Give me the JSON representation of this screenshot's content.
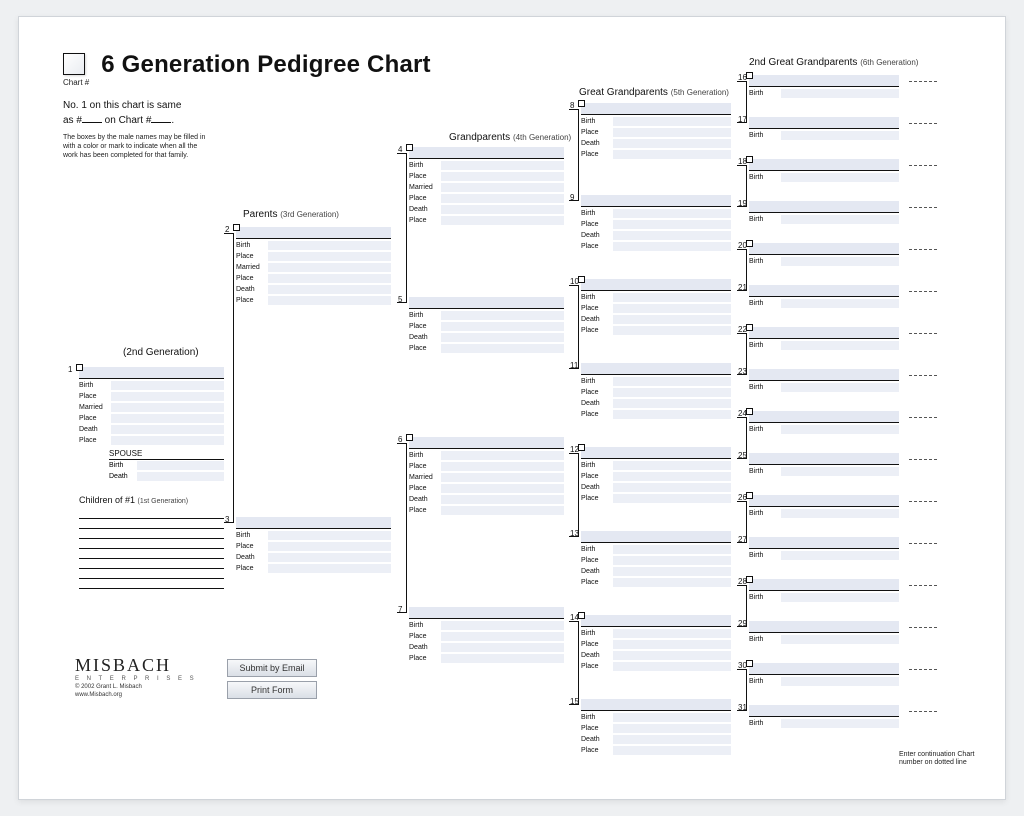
{
  "title": "6 Generation Pedigree Chart",
  "chart_num_label": "Chart #",
  "intro_line1": "No. 1 on this chart is same",
  "intro_line2a": "as #",
  "intro_line2b": " on Chart #",
  "intro_line2c": ".",
  "micro_note": "The boxes by the male names may be filled in with a color or mark to indicate when all the work has been completed for that family.",
  "gens": {
    "g2": "(2nd Generation)",
    "g3": "Parents",
    "g3sub": "(3rd Generation)",
    "g4": "Grandparents",
    "g4sub": "(4th Generation)",
    "g5": "Great Grandparents",
    "g5sub": "(5th Generation)",
    "g6": "2nd Great Grandparents",
    "g6sub": "(6th Generation)"
  },
  "fields_full": [
    "Birth",
    "Place",
    "Married",
    "Place",
    "Death",
    "Place"
  ],
  "fields_short": [
    "Birth",
    "Place",
    "Death",
    "Place"
  ],
  "fields_birth": [
    "Birth"
  ],
  "spouse_label": "SPOUSE",
  "spouse_fields": [
    "Birth",
    "Death"
  ],
  "children_label": "Children of #1",
  "children_sub": "(1st Generation)",
  "buttons": {
    "submit": "Submit by Email",
    "print": "Print Form"
  },
  "logo": {
    "brand": "MISBACH",
    "sub": "E N T E R P R I S E S",
    "copy1": "© 2002 Grant L. Misbach",
    "copy2": "www.Misbach.org"
  },
  "cont_note": "Enter continuation Chart number on dotted line"
}
